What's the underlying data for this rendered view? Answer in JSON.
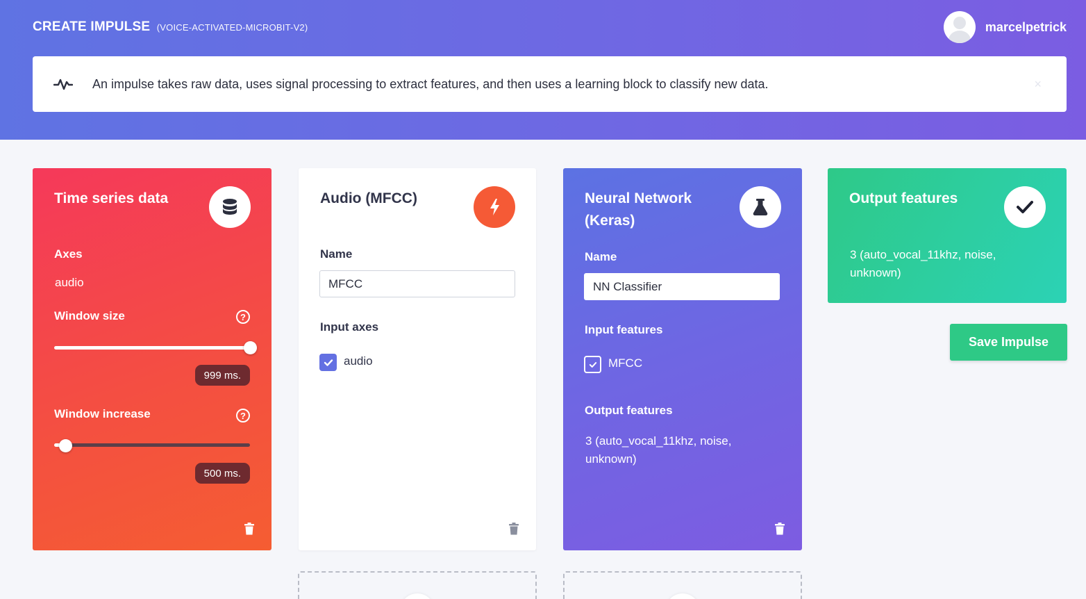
{
  "header": {
    "title": "CREATE IMPULSE",
    "project": "(VOICE-ACTIVATED-MICROBIT-V2)",
    "username": "marcelpetrick"
  },
  "info": {
    "text": "An impulse takes raw data, uses signal processing to extract features, and then uses a learning block to classify new data.",
    "close": "×"
  },
  "input_block": {
    "title": "Time series data",
    "icon": "database-icon",
    "axes_label": "Axes",
    "axes_value": "audio",
    "window_size_label": "Window size",
    "window_size_value": "999 ms.",
    "window_size_fraction": 1.0,
    "window_increase_label": "Window increase",
    "window_increase_value": "500 ms.",
    "window_increase_fraction": 0.06,
    "help": "?"
  },
  "processing_block": {
    "title": "Audio (MFCC)",
    "icon": "lightning-icon",
    "name_label": "Name",
    "name_value": "MFCC",
    "input_axes_label": "Input axes",
    "axis_item": "audio"
  },
  "learning_block": {
    "title_line1": "Neural Network",
    "title_line2": "(Keras)",
    "icon": "flask-icon",
    "name_label": "Name",
    "name_value": "NN Classifier",
    "input_features_label": "Input features",
    "feature_item": "MFCC",
    "output_features_label": "Output features",
    "output_line1": "3 (auto_vocal_11khz, noise,",
    "output_line2": "unknown)"
  },
  "output_block": {
    "title": "Output features",
    "icon": "check-icon",
    "line1": "3 (auto_vocal_11khz, noise,",
    "line2": "unknown)"
  },
  "save_button": "Save Impulse",
  "colors": {
    "header": "#6d69e3",
    "input_block": "#f5395a",
    "processing_accent": "#f55a36",
    "learning_block": "#6f66e3",
    "output_block": "#2ec988",
    "save_button": "#2ec986"
  }
}
